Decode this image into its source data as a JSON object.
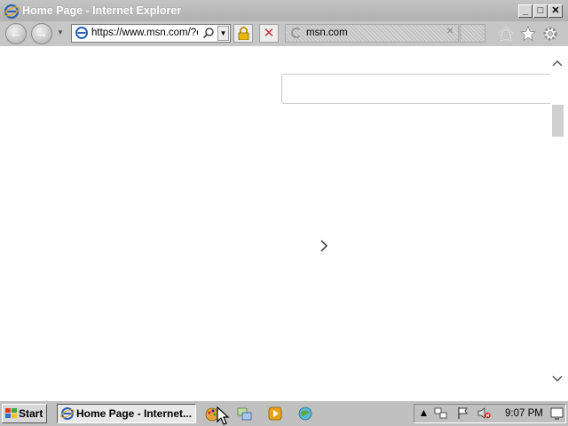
{
  "window": {
    "title": "Home Page - Internet Explorer",
    "controls": [
      "_",
      "□",
      "✕"
    ]
  },
  "toolbar": {
    "address": "https://www.msn.com/?c",
    "tab_label": "msn.com",
    "icons": [
      "back-icon",
      "forward-icon",
      "lock-icon",
      "stop-icon",
      "home-icon",
      "favorites-star-icon",
      "settings-gear-icon"
    ]
  },
  "content": {
    "search_value": "",
    "next_arrow": "›"
  },
  "taskbar": {
    "start_label": "Start",
    "active_task_label": "Home Page - Internet...",
    "clock": "9:07 PM"
  },
  "colors": {
    "chrome_gray": "#c0c0c0",
    "titlebar": "#b8b8b8",
    "start_red": "#c00000"
  }
}
